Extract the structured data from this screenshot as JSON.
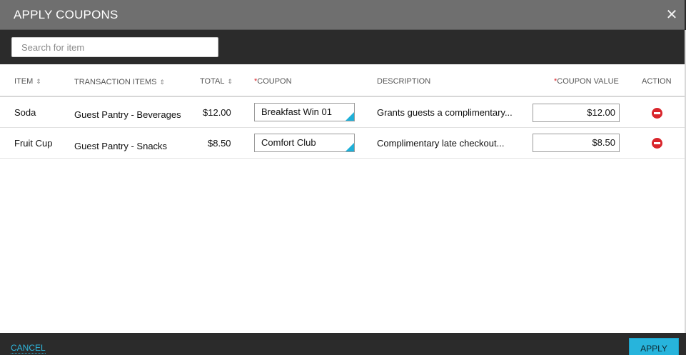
{
  "dialog": {
    "title": "APPLY COUPONS",
    "close_glyph": "✕"
  },
  "search": {
    "placeholder": "Search for item",
    "value": ""
  },
  "table": {
    "headers": {
      "item": "ITEM",
      "transaction_items": "TRANSACTION ITEMS",
      "total": "TOTAL",
      "coupon_required": "*",
      "coupon": "COUPON",
      "description": "DESCRIPTION",
      "coupon_value_required": "*",
      "coupon_value": "COUPON VALUE",
      "action": "ACTION"
    },
    "sort_glyph": "⇕",
    "rows": [
      {
        "item": "Soda",
        "transaction_item": "Guest Pantry - Beverages",
        "total": "$12.00",
        "coupon": "Breakfast Win 01",
        "description": "Grants guests a complimentary...",
        "coupon_value": "$12.00"
      },
      {
        "item": "Fruit Cup",
        "transaction_item": "Guest Pantry - Snacks",
        "total": "$8.50",
        "coupon": "Comfort Club",
        "description": "Complimentary late checkout...",
        "coupon_value": "$8.50"
      }
    ]
  },
  "footer": {
    "cancel_label": "CANCEL",
    "apply_label": "APPLY"
  },
  "colors": {
    "accent": "#27b4dc",
    "danger": "#d9262c",
    "header_bg": "#6f6f6f",
    "bar_bg": "#2b2b2b"
  },
  "icons": {
    "close": "close-icon",
    "sort": "sort-icon",
    "dropdown": "dropdown-corner-icon",
    "remove": "remove-circle-icon"
  }
}
